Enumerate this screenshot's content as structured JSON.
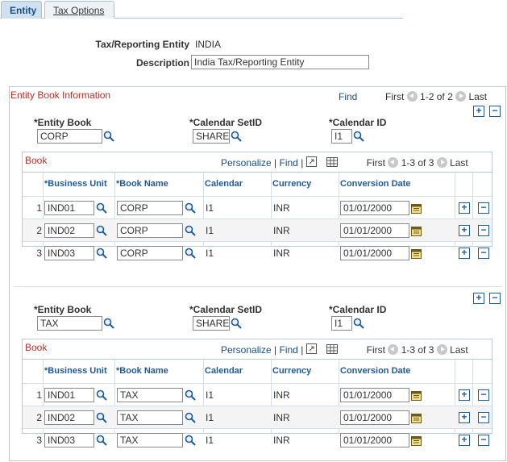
{
  "tabs": [
    {
      "label": "Entity",
      "active": true
    },
    {
      "label": "Tax Options",
      "active": false
    }
  ],
  "header": {
    "entity_label": "Tax/Reporting Entity",
    "entity_value": "INDIA",
    "description_label": "Description",
    "description_value": "India Tax/Reporting Entity"
  },
  "group": {
    "title": "Entity Book Information",
    "find": "Find",
    "first": "First",
    "range": "1-2 of 2",
    "last": "Last"
  },
  "field_labels": {
    "entity_book": "*Entity Book",
    "calendar_setid": "*Calendar SetID",
    "calendar_id": "*Calendar ID"
  },
  "grid_toolbar": {
    "title": "Book",
    "personalize": "Personalize",
    "pipe": "|",
    "find": "Find",
    "first": "First",
    "range": "1-3 of 3",
    "last": "Last"
  },
  "columns": [
    "*Business Unit",
    "*Book Name",
    "Calendar",
    "Currency",
    "Conversion Date"
  ],
  "books": [
    {
      "entity_book": "CORP",
      "calendar_setid": "SHARE",
      "calendar_id": "I1",
      "rows": [
        {
          "num": "1",
          "business_unit": "IND01",
          "book_name": "CORP",
          "calendar": "I1",
          "currency": "INR",
          "date": "01/01/2000"
        },
        {
          "num": "2",
          "business_unit": "IND02",
          "book_name": "CORP",
          "calendar": "I1",
          "currency": "INR",
          "date": "01/01/2000"
        },
        {
          "num": "3",
          "business_unit": "IND03",
          "book_name": "CORP",
          "calendar": "I1",
          "currency": "INR",
          "date": "01/01/2000"
        }
      ]
    },
    {
      "entity_book": "TAX",
      "calendar_setid": "SHARE",
      "calendar_id": "I1",
      "rows": [
        {
          "num": "1",
          "business_unit": "IND01",
          "book_name": "TAX",
          "calendar": "I1",
          "currency": "INR",
          "date": "01/01/2000"
        },
        {
          "num": "2",
          "business_unit": "IND02",
          "book_name": "TAX",
          "calendar": "I1",
          "currency": "INR",
          "date": "01/01/2000"
        },
        {
          "num": "3",
          "business_unit": "IND03",
          "book_name": "TAX",
          "calendar": "I1",
          "currency": "INR",
          "date": "01/01/2000"
        }
      ]
    }
  ],
  "icons": {
    "lookup": "magnifier-icon",
    "calendar": "calendar-icon",
    "add": "+",
    "delete": "−",
    "zoom": "zoom-icon",
    "download": "grid-download-icon"
  }
}
